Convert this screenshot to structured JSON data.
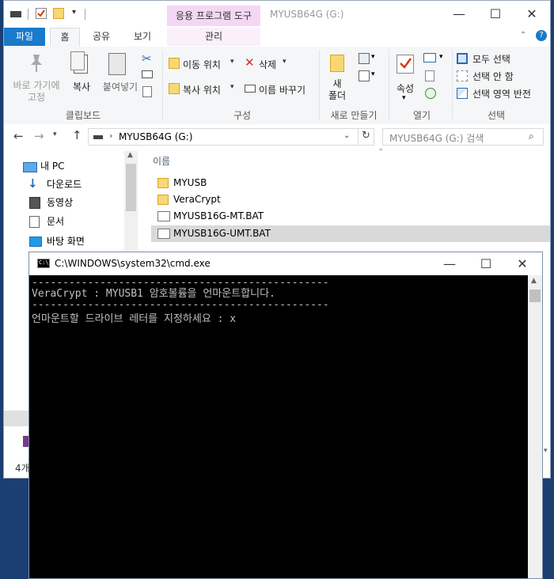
{
  "explorer": {
    "context_tab": "응용 프로그램 도구",
    "title": "MYUSB64G (G:)",
    "tabs": {
      "file": "파일",
      "home": "홈",
      "share": "공유",
      "view": "보기",
      "manage": "관리"
    },
    "ribbon": {
      "pin": "바로 가기에\n고정",
      "copy": "복사",
      "paste": "붙여넣기",
      "clipboard_group": "클립보드",
      "move_to": "이동 위치",
      "copy_to": "복사 위치",
      "delete": "삭제",
      "rename": "이름 바꾸기",
      "organize_group": "구성",
      "new_folder": "새\n폴더",
      "new_group": "새로 만들기",
      "properties": "속성",
      "open_group": "열기",
      "select_all": "모두 선택",
      "select_none": "선택 안 함",
      "invert_selection": "선택 영역 반전",
      "select_group": "선택"
    },
    "address": {
      "path": "MYUSB64G (G:)",
      "search_placeholder": "MYUSB64G (G:) 검색"
    },
    "nav": {
      "this_pc": "내 PC",
      "downloads": "다운로드",
      "videos": "동영상",
      "documents": "문서",
      "desktop": "바탕 화면"
    },
    "list": {
      "col_name": "이름",
      "items": [
        "MYUSB",
        "VeraCrypt",
        "MYUSB16G-MT.BAT",
        "MYUSB16G-UMT.BAT"
      ]
    },
    "status": {
      "item_count": "4개"
    }
  },
  "cmd": {
    "title": "C:\\WINDOWS\\system32\\cmd.exe",
    "lines": [
      "------------------------------------------------",
      "VeraCrypt : MYUSB1 암호볼륨을 언마운트합니다.",
      "------------------------------------------------",
      "언마운트할 드라이브 레터를 지정하세요 : x"
    ]
  },
  "colors": {
    "file_tab": "#1979ca",
    "context_tab": "#f3d7f4",
    "desktop": "#1b3f73",
    "console_bg": "#000000",
    "console_fg": "#c0c0c0"
  }
}
